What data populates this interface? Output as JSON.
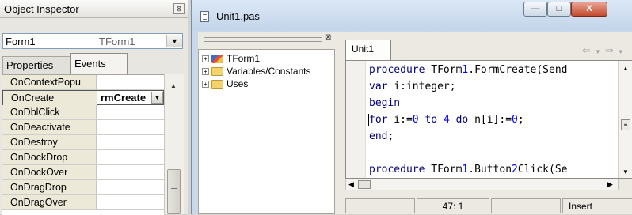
{
  "object_inspector": {
    "title": "Object Inspector",
    "close_glyph": "⊠",
    "component_name": "Form1",
    "component_class": "TForm1",
    "tabs": [
      {
        "label": "Properties",
        "active": false
      },
      {
        "label": "Events",
        "active": true
      }
    ],
    "rows": [
      {
        "name": "OnContextPopu",
        "value": ""
      },
      {
        "name": "OnCreate",
        "value": "rmCreate",
        "selected": true
      },
      {
        "name": "OnDblClick",
        "value": ""
      },
      {
        "name": "OnDeactivate",
        "value": ""
      },
      {
        "name": "OnDestroy",
        "value": ""
      },
      {
        "name": "OnDockDrop",
        "value": ""
      },
      {
        "name": "OnDockOver",
        "value": ""
      },
      {
        "name": "OnDragDrop",
        "value": ""
      },
      {
        "name": "OnDragOver",
        "value": ""
      }
    ]
  },
  "editor": {
    "window_title": "Unit1.pas",
    "window_buttons": {
      "minimize": "—",
      "maximize": "□",
      "close": "X"
    },
    "tree": [
      {
        "label": "TForm1",
        "icon": "component-icon"
      },
      {
        "label": "Variables/Constants",
        "icon": "folder-icon"
      },
      {
        "label": "Uses",
        "icon": "folder-icon"
      }
    ],
    "tab_label": "Unit1",
    "code_lines": [
      {
        "kw": "procedure",
        "rest": " TForm1.FormCreate(Send"
      },
      {
        "kw": "var",
        "rest": " i:integer;"
      },
      {
        "kw": "begin",
        "rest": ""
      },
      {
        "kw": "for",
        "rest": " i:=0 to 4 do n[i]:=0;"
      },
      {
        "kw": "end",
        "rest": ";"
      },
      {
        "kw": "",
        "rest": ""
      },
      {
        "kw": "procedure",
        "rest": " TForm1.Button2Click(Se"
      }
    ],
    "status": {
      "cursor_position": "47:  1",
      "insert_mode": "Insert"
    }
  }
}
